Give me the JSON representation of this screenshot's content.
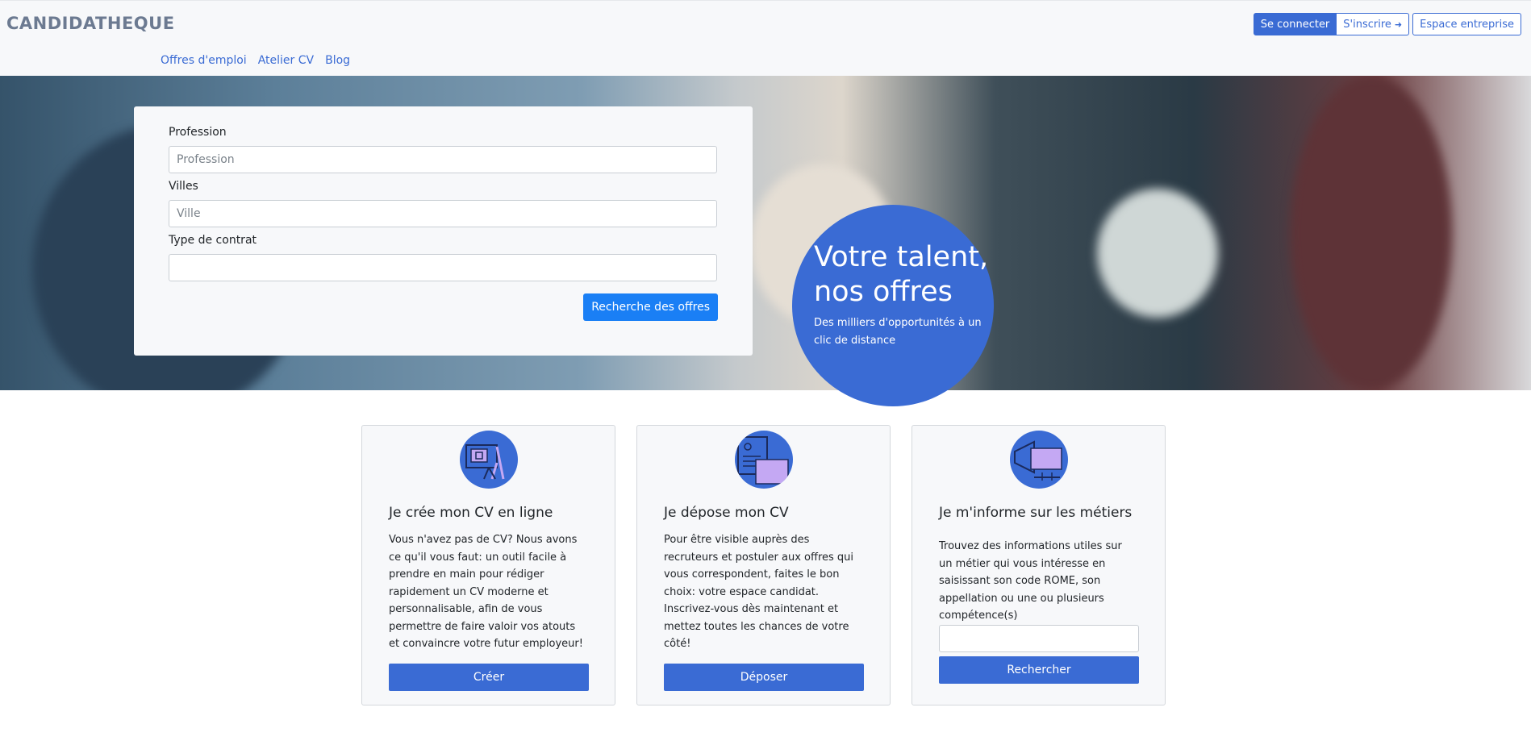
{
  "header": {
    "brand": "CANDIDATHEQUE",
    "login_label": "Se connecter",
    "signup_label": "S'inscrire",
    "business_label": "Espace entreprise",
    "nav": [
      {
        "label": "Offres d'emploi"
      },
      {
        "label": "Atelier CV"
      },
      {
        "label": "Blog"
      }
    ]
  },
  "search": {
    "profession_label": "Profession",
    "profession_placeholder": "Profession",
    "city_label": "Villes",
    "city_placeholder": "Ville",
    "contract_label": "Type de contrat",
    "contract_value": "",
    "submit_label": "Recherche des offres"
  },
  "hero": {
    "title_line1": "Votre talent,",
    "title_line2": "nos offres",
    "subtitle": "Des milliers d'opportunités à un clic de distance"
  },
  "cards": [
    {
      "icon": "cv-builder-icon",
      "title": "Je crée mon CV en ligne",
      "text": "Vous n'avez pas de CV? Nous avons ce qu'il vous faut: un outil facile à prendre en main pour rédiger rapidement un CV moderne et personnalisable, afin de vous permettre de faire valoir vos atouts et convaincre votre futur employeur!",
      "button": "Créer"
    },
    {
      "icon": "upload-cv-icon",
      "title": "Je dépose mon CV",
      "text": "Pour être visible auprès des recruteurs et postuler aux offres qui vous correspondent, faites le bon choix: votre espace candidat. Inscrivez-vous dès maintenant et mettez toutes les chances de votre côté!",
      "button": "Déposer"
    },
    {
      "icon": "megaphone-icon",
      "title": "Je m'informe sur les métiers",
      "text": "Trouvez des informations utiles sur un métier qui vous intéresse en saisissant son code ROME, son appellation ou une ou plusieurs compétence(s)",
      "input_value": "",
      "button": "Rechercher"
    }
  ],
  "colors": {
    "primary": "#3a6bd4",
    "search_button": "#1a7ff5",
    "header_bg": "#f7f8fa"
  }
}
